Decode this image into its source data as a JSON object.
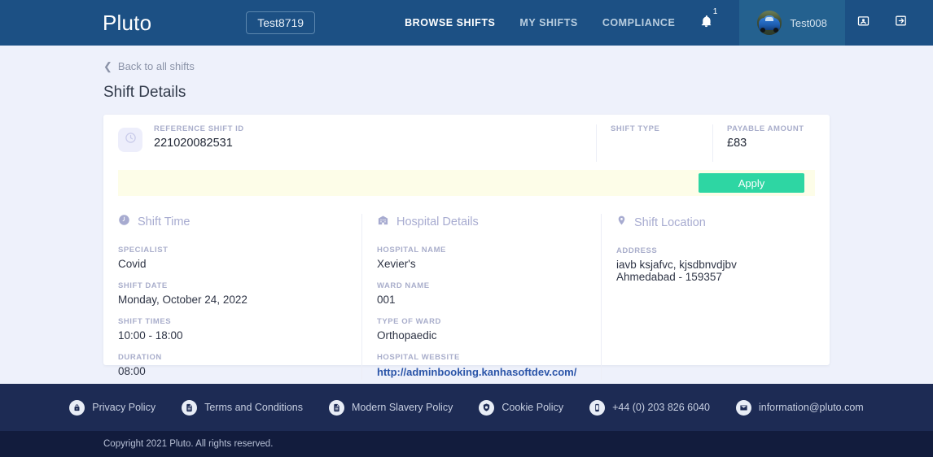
{
  "header": {
    "brand": "Pluto",
    "shift_badge": "Test8719",
    "nav": [
      {
        "label": "BROWSE SHIFTS",
        "active": true
      },
      {
        "label": "MY SHIFTS",
        "active": false
      },
      {
        "label": "COMPLIANCE",
        "active": false
      }
    ],
    "notification_icon": "bell-icon",
    "notification_count": "1",
    "user_name": "Test008",
    "avatar_icon": "avatar-car-photo",
    "id_card_icon": "id-card-icon",
    "logout_icon": "logout-icon"
  },
  "page": {
    "back_link": "Back to all shifts",
    "back_icon": "chevron-left-icon",
    "title": "Shift Details"
  },
  "summary": {
    "icon": "clock-icon",
    "reference_label": "REFERENCE SHIFT ID",
    "reference_value": "221020082531",
    "shift_type_label": "SHIFT TYPE",
    "shift_type_value": "",
    "payable_label": "PAYABLE AMOUNT",
    "payable_value": "£83",
    "apply_label": "Apply"
  },
  "sections": {
    "shift_time": {
      "icon": "clock-icon",
      "title": "Shift Time",
      "fields": [
        {
          "label": "SPECIALIST",
          "value": "Covid"
        },
        {
          "label": "SHIFT DATE",
          "value": "Monday, October 24, 2022"
        },
        {
          "label": "SHIFT TIMES",
          "value": "10:00 - 18:00"
        },
        {
          "label": "DURATION",
          "value": "08:00"
        }
      ]
    },
    "hospital_details": {
      "icon": "hospital-building-icon",
      "title": "Hospital Details",
      "fields": [
        {
          "label": "HOSPITAL NAME",
          "value": "Xevier's"
        },
        {
          "label": "WARD NAME",
          "value": "001"
        },
        {
          "label": "TYPE OF WARD",
          "value": "Orthopaedic"
        }
      ],
      "website_label": "HOSPITAL WEBSITE",
      "website_value": "http://adminbooking.kanhasoftdev.com/"
    },
    "shift_location": {
      "icon": "location-pin-icon",
      "title": "Shift Location",
      "address_label": "ADDRESS",
      "address_line1": "iavb ksjafvc, kjsdbnvdjbv",
      "address_line2": "Ahmedabad - 159357"
    }
  },
  "footer": {
    "links": [
      {
        "icon": "lock-icon",
        "label": "Privacy Policy"
      },
      {
        "icon": "document-icon",
        "label": "Terms and Conditions"
      },
      {
        "icon": "document-icon",
        "label": "Modern Slavery Policy"
      },
      {
        "icon": "cookie-shield-icon",
        "label": "Cookie Policy"
      },
      {
        "icon": "phone-icon",
        "label": "+44 (0) 203 826 6040"
      },
      {
        "icon": "envelope-icon",
        "label": "information@pluto.com"
      }
    ],
    "copyright": "Copyright 2021 Pluto. All rights reserved."
  },
  "colors": {
    "header_bg": "#1c5084",
    "accent_green": "#2ed6a3",
    "apply_strip": "#fdfde8",
    "footer_bg": "#1d2b54",
    "copyright_bg": "#121c3d",
    "link_blue": "#2a54a8"
  }
}
